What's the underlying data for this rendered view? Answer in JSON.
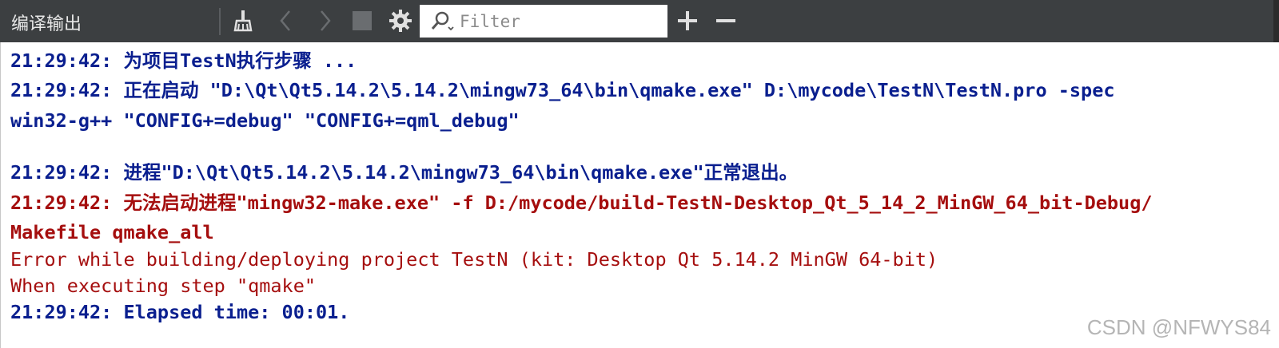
{
  "panel": {
    "title": "编译输出"
  },
  "toolbar": {
    "icons": [
      "clean-icon",
      "chevron-left-icon",
      "chevron-right-icon",
      "stop-icon",
      "gear-icon",
      "zoom-in-icon",
      "zoom-out-icon"
    ]
  },
  "filter": {
    "placeholder": "Filter",
    "value": ""
  },
  "output": {
    "lines": [
      {
        "kind": "info",
        "text": "21:29:42: 为项目TestN执行步骤 ..."
      },
      {
        "kind": "info",
        "text": "21:29:42: 正在启动 \"D:\\Qt\\Qt5.14.2\\5.14.2\\mingw73_64\\bin\\qmake.exe\" D:\\mycode\\TestN\\TestN.pro -spec"
      },
      {
        "kind": "info",
        "text": "win32-g++ \"CONFIG+=debug\" \"CONFIG+=qml_debug\""
      },
      {
        "kind": "info",
        "text": "21:29:42: 进程\"D:\\Qt\\Qt5.14.2\\5.14.2\\mingw73_64\\bin\\qmake.exe\"正常退出。"
      },
      {
        "kind": "error-bold",
        "text": "21:29:42: 无法启动进程\"mingw32-make.exe\" -f D:/mycode/build-TestN-Desktop_Qt_5_14_2_MinGW_64_bit-Debug/"
      },
      {
        "kind": "error-bold",
        "text": "Makefile qmake_all"
      },
      {
        "kind": "error",
        "text": "Error while building/deploying project TestN (kit: Desktop Qt 5.14.2 MinGW 64-bit)"
      },
      {
        "kind": "error",
        "text": "When executing step \"qmake\""
      },
      {
        "kind": "info",
        "text": "21:29:42: Elapsed time: 00:01."
      }
    ]
  },
  "colors": {
    "toolbar_bg": "#3c3f41",
    "info_text": "#0a1f8f",
    "error_text": "#a50e0e"
  },
  "watermark": "CSDN @NFWYS84"
}
